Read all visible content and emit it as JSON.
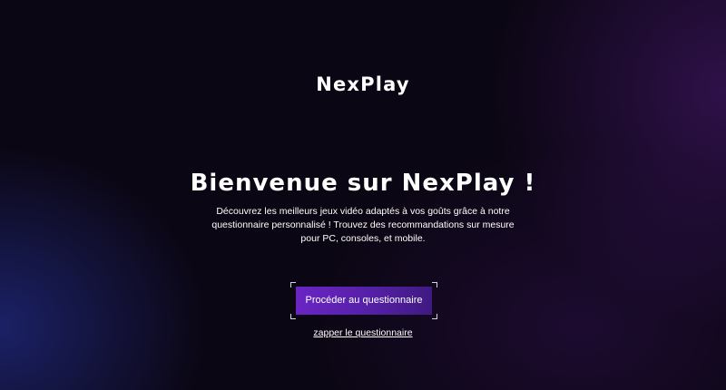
{
  "brand": {
    "logo_text": "NexPlay"
  },
  "hero": {
    "title": "Bienvenue sur NexPlay !",
    "description": "Découvrez les meilleurs jeux vidéo adaptés à vos goûts grâce à notre questionnaire personnalisé ! Trouvez des recommandations sur mesure pour PC, consoles, et mobile."
  },
  "actions": {
    "primary_label": "Procéder au questionnaire",
    "skip_label": "zapper le questionnaire"
  },
  "colors": {
    "background": "#0b0613",
    "button_start": "#6a25c4",
    "button_end": "#3f1a82",
    "text": "#ffffff"
  }
}
